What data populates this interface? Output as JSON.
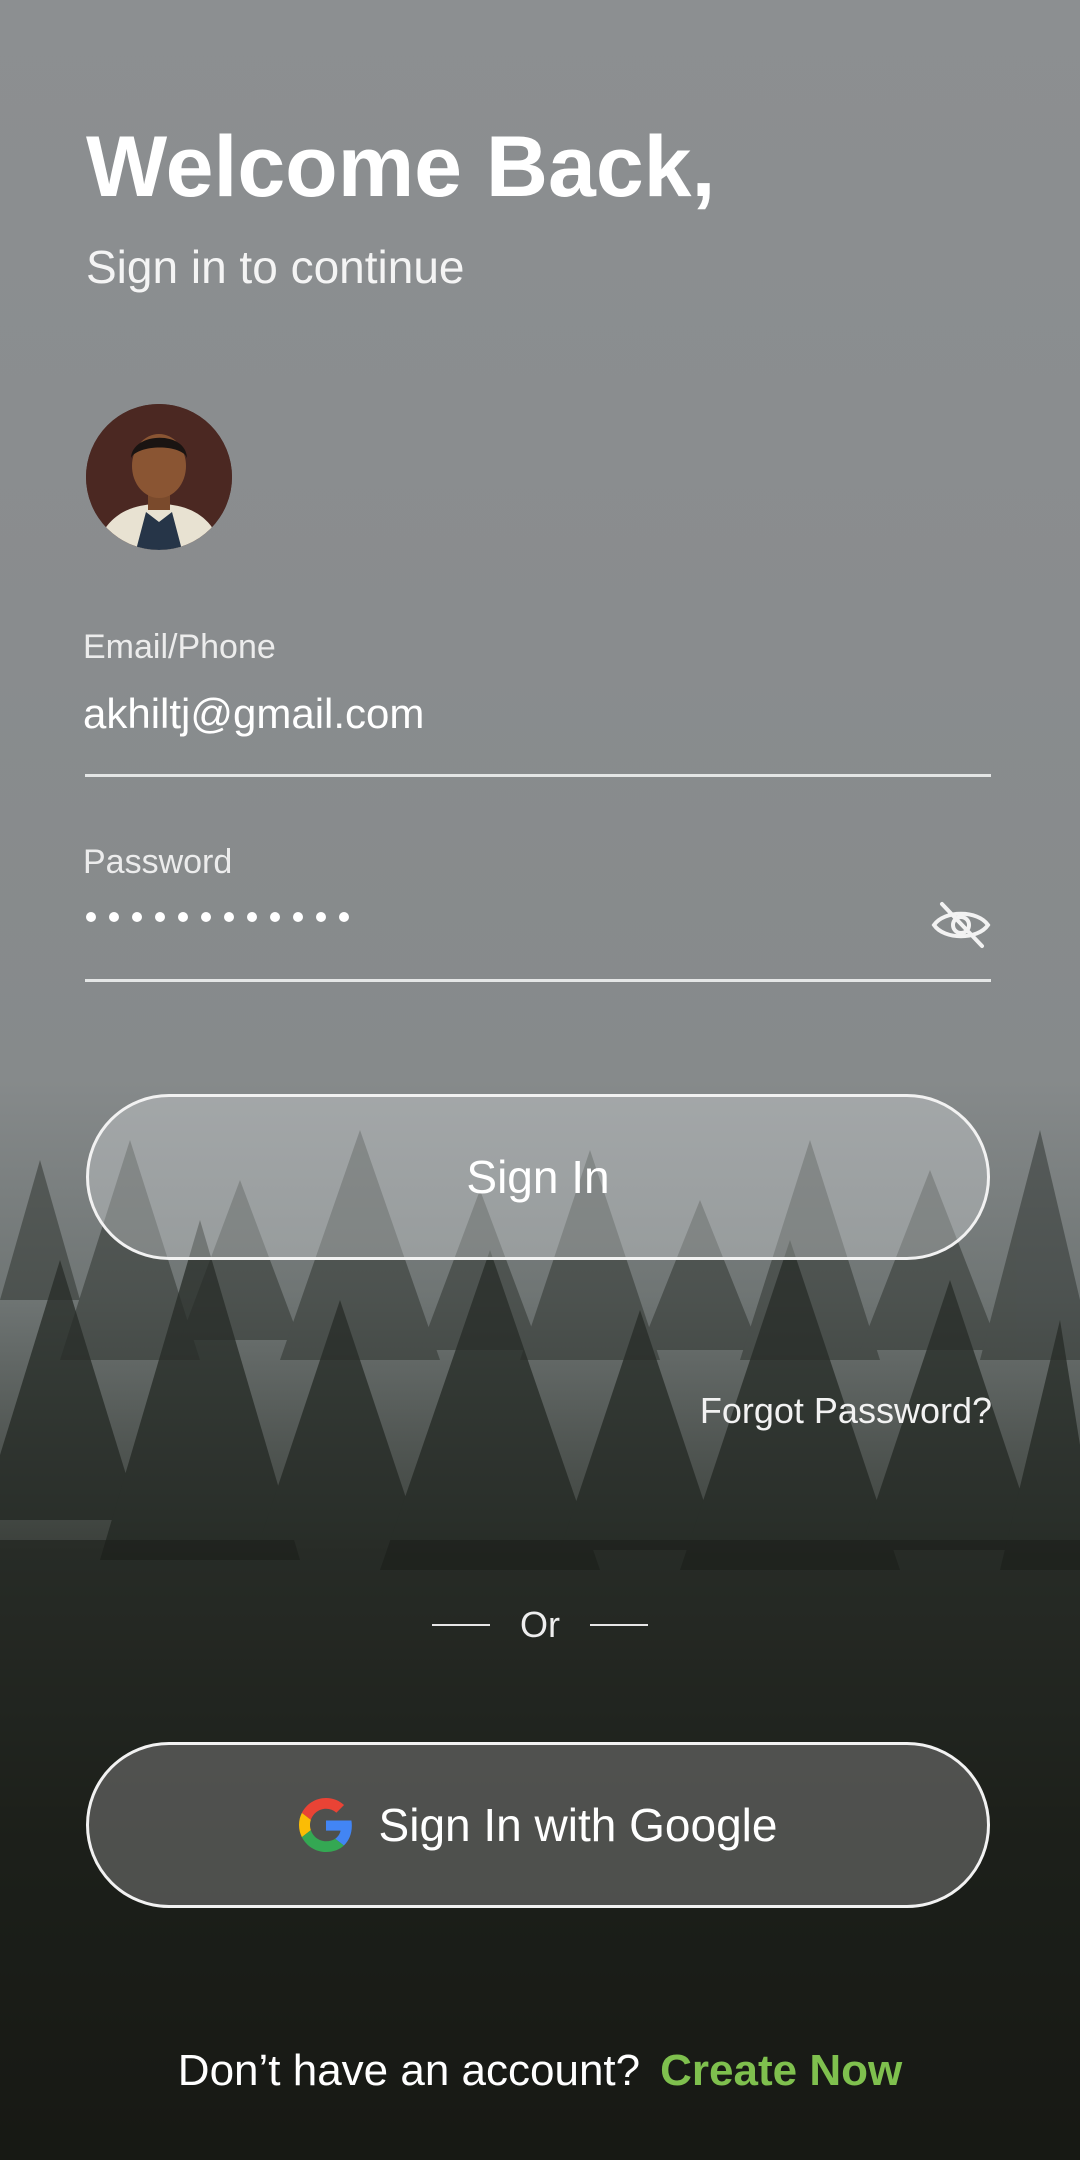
{
  "header": {
    "title": "Welcome Back,",
    "subtitle": "Sign in to continue"
  },
  "form": {
    "email_label": "Email/Phone",
    "email_value": "akhiltj@gmail.com",
    "password_label": "Password",
    "password_mask_count": 12,
    "password_visibility_icon": "eye-off-icon"
  },
  "actions": {
    "signin_label": "Sign In",
    "forgot_label": "Forgot Password?",
    "or_label": "Or",
    "google_label": "Sign In with Google",
    "google_icon": "google-logo-icon"
  },
  "footer": {
    "question": "Don’t have an account?",
    "link": "Create Now"
  },
  "colors": {
    "accent_link": "#7fc04e",
    "google_blue": "#4285F4",
    "google_red": "#EA4335",
    "google_yellow": "#FBBC05",
    "google_green": "#34A853"
  }
}
